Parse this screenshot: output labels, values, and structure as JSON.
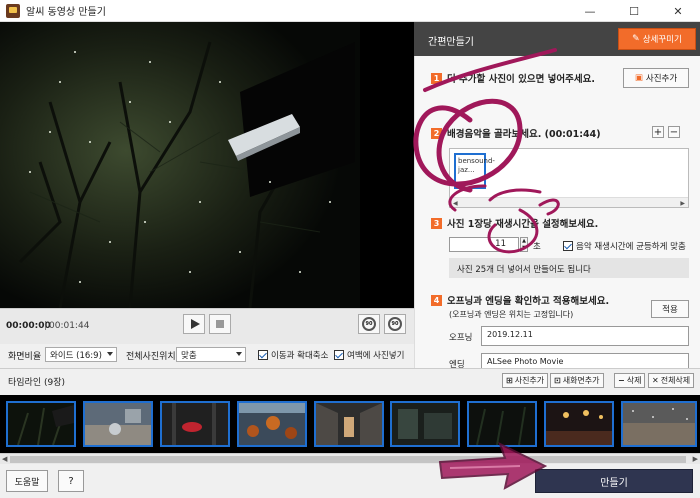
{
  "window": {
    "title": "알씨 동영상 만들기",
    "minimize": "—",
    "maximize": "☐",
    "close": "✕"
  },
  "player": {
    "current_time": "00:00:00",
    "separator": "|",
    "total_time": "00:01:44",
    "rotate_left": "90",
    "rotate_right": "90"
  },
  "options": {
    "aspect_label": "화면비율",
    "aspect_value": "와이드 (16:9)",
    "position_label": "전체사진위치",
    "position_value": "맞춤",
    "pan_zoom_label": "이동과 확대축소",
    "margin_label": "여백에 사진넣기"
  },
  "panel": {
    "title": "간편만들기",
    "detail_button": "상세꾸미기",
    "step1_num": "1",
    "step1_text": "더 추가할 사진이 있으면 넣어주세요.",
    "add_photo_button": "사진추가",
    "step2_num": "2",
    "step2_text": "배경음악을 골라보세요. (00:01:44)",
    "music_add": "+",
    "music_remove": "−",
    "music_item": "bensound-jaz...",
    "step3_num": "3",
    "step3_text": "사진 1장당 재생시간을 설정해보세요.",
    "seconds_value": "11",
    "seconds_unit": "초",
    "fit_music_label": "음악 재생시간에 균등하게 맞춤",
    "hint_text": "사진 25개 더 넣어서 만들어도 됩니다",
    "step4_num": "4",
    "step4_text": "오프닝과 엔딩을 확인하고 적용해보세요.",
    "step4_sub": "(오프닝과 엔딩은 위치는 고정입니다)",
    "apply_button": "적용",
    "opening_label": "오프닝",
    "opening_value": "2019.12.11",
    "ending_label": "엔딩",
    "ending_value": "ALSee Photo Movie"
  },
  "timeline": {
    "title": "타임라인 (9장)",
    "add_photo": "사진추가",
    "new_screen": "새화면추가",
    "delete": "삭제",
    "delete_all": "전체삭제"
  },
  "bottom": {
    "help": "도움말",
    "question": "?",
    "make": "만들기"
  },
  "colors": {
    "accent": "#f26c2a",
    "make_button": "#2f3550",
    "selection": "#1f6fd1",
    "scribble": "#a0185a"
  }
}
